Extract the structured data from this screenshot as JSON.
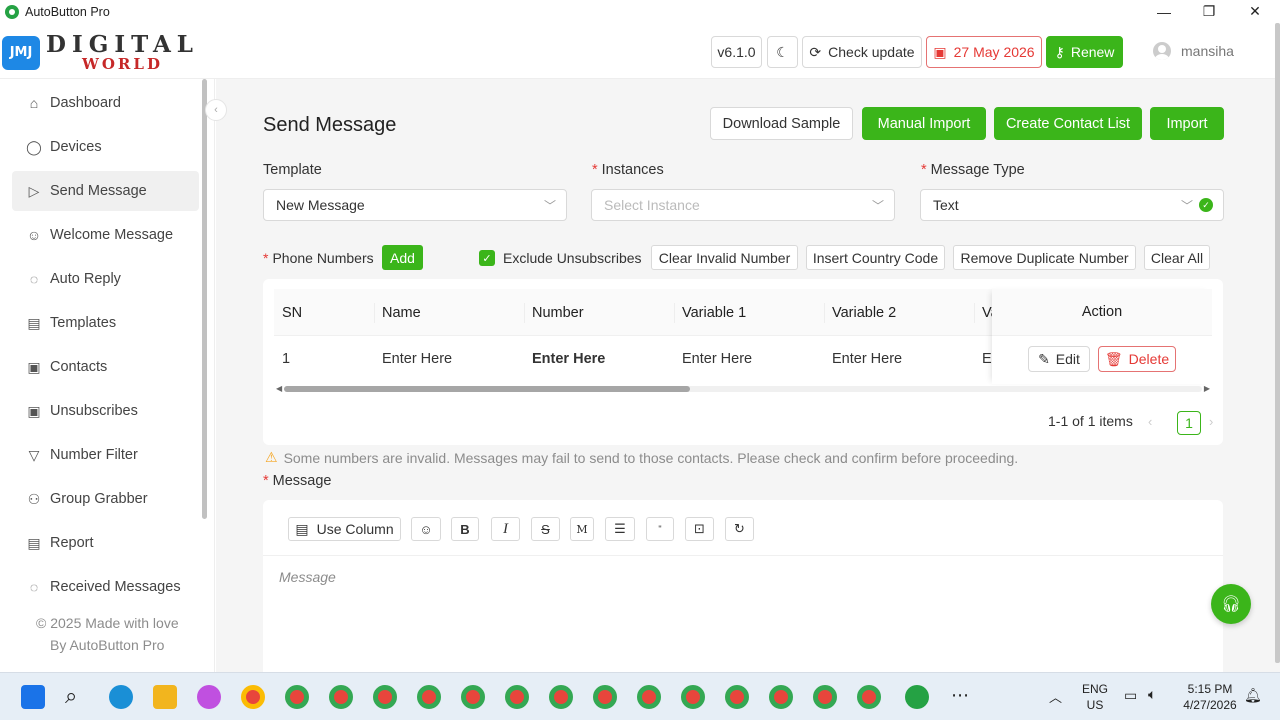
{
  "window": {
    "title": "AutoButton Pro",
    "minimize": "—",
    "maximize": "❐",
    "close": "✕"
  },
  "header": {
    "logo_badge": "JMJ",
    "logo_line1": "DIGITAL",
    "logo_line2": "WORLD",
    "version": "v6.1.0",
    "check_update": "Check update",
    "date": "27 May 2026",
    "renew": "Renew",
    "username": "mansiha"
  },
  "sidebar": {
    "items": [
      {
        "label": "Dashboard",
        "icon": "home-icon"
      },
      {
        "label": "Devices",
        "icon": "whatsapp-icon"
      },
      {
        "label": "Send Message",
        "icon": "send-icon"
      },
      {
        "label": "Welcome Message",
        "icon": "smile-icon"
      },
      {
        "label": "Auto Reply",
        "icon": "chat-icon"
      },
      {
        "label": "Templates",
        "icon": "document-icon"
      },
      {
        "label": "Contacts",
        "icon": "contacts-icon"
      },
      {
        "label": "Unsubscribes",
        "icon": "unsubscribe-icon"
      },
      {
        "label": "Number Filter",
        "icon": "filter-icon"
      },
      {
        "label": "Group Grabber",
        "icon": "group-icon"
      },
      {
        "label": "Report",
        "icon": "report-icon"
      },
      {
        "label": "Received Messages",
        "icon": "inbox-icon"
      }
    ],
    "active_index": 2,
    "footer_line1": "© 2025 Made with love",
    "footer_line2": "By AutoButton Pro"
  },
  "main": {
    "title": "Send Message",
    "buttons": {
      "download_sample": "Download Sample",
      "manual_import": "Manual Import",
      "create_contact_list": "Create Contact List",
      "import": "Import"
    },
    "fields": {
      "template_label": "Template",
      "template_value": "New Message",
      "instances_label": "Instances",
      "instances_placeholder": "Select Instance",
      "message_type_label": "Message Type",
      "message_type_value": "Text",
      "required_mark": "*"
    },
    "phone": {
      "label": "Phone Numbers",
      "add": "Add",
      "exclude_unsubscribes": "Exclude Unsubscribes",
      "exclude_checked": true,
      "clear_invalid": "Clear Invalid Number",
      "insert_country_code": "Insert Country Code",
      "remove_duplicate": "Remove Duplicate Number",
      "clear_all": "Clear All"
    },
    "table": {
      "headers": [
        "SN",
        "Name",
        "Number",
        "Variable 1",
        "Variable 2",
        "Va",
        "Action"
      ],
      "rows": [
        {
          "sn": "1",
          "name": "Enter Here",
          "number": "Enter Here",
          "var1": "Enter Here",
          "var2": "Enter Here",
          "var3": "Er"
        }
      ],
      "edit": "Edit",
      "delete": "Delete",
      "pagination_summary": "1-1 of 1 items",
      "current_page": "1"
    },
    "warning": "Some numbers are invalid. Messages may fail to send to those contacts. Please check and confirm before proceeding.",
    "message_label": "Message",
    "editor": {
      "use_column": "Use Column",
      "bold": "B",
      "italic": "I",
      "strike": "S",
      "mono": "M",
      "quote": "\"",
      "placeholder": "Message"
    }
  },
  "taskbar": {
    "lang_line1": "ENG",
    "lang_line2": "US",
    "time": "5:15 PM",
    "date": "4/27/2026"
  },
  "colors": {
    "accent": "#3bb51a",
    "danger": "#e53935",
    "brand_blue": "#1e88e5"
  }
}
